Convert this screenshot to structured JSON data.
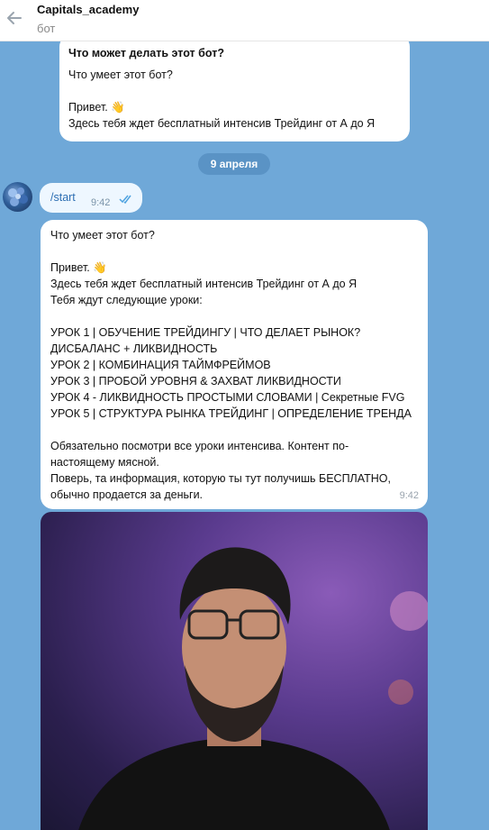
{
  "header": {
    "title": "Capitals_academy",
    "subtitle": "бот"
  },
  "description": {
    "title": "Что может делать этот бот?",
    "lines": [
      "Что умеет этот бот?",
      "",
      "Привет. 👋",
      "Здесь тебя ждет бесплатный интенсив Трейдинг от А до Я"
    ]
  },
  "date_pill": "9 апреля",
  "outgoing": {
    "text": "/start",
    "time": "9:42"
  },
  "message": {
    "lines": [
      "Что умеет этот бот?",
      "",
      "Привет. 👋",
      "Здесь тебя ждет бесплатный интенсив Трейдинг от А до Я",
      "Тебя ждут следующие уроки:",
      "",
      "УРОК 1 | ОБУЧЕНИЕ ТРЕЙДИНГУ | ЧТО ДЕЛАЕТ РЫНОК?",
      "ДИСБАЛАНС + ЛИКВИДНОСТЬ",
      "УРОК 2 | КОМБИНАЦИЯ ТАЙМФРЕЙМОВ",
      "УРОК 3 | ПРОБОЙ УРОВНЯ & ЗАХВАТ ЛИКВИДНОСТИ",
      "УРОК 4 - ЛИКВИДНОСТЬ ПРОСТЫМИ СЛОВАМИ | Секретные FVG",
      "УРОК 5 | СТРУКТУРА РЫНКА ТРЕЙДИНГ | ОПРЕДЕЛЕНИЕ ТРЕНДА",
      "",
      "Обязательно посмотри все уроки интенсива. Контент по-",
      "настоящему мясной.",
      "Поверь, та информация, которую ты тут получишь БЕСПЛАТНО,",
      "обычно продается за деньги."
    ],
    "time": "9:42"
  },
  "colors": {
    "chat_background": "#6fa8d8",
    "outgoing_bubble": "#eef7ff",
    "date_pill": "#5a93c5"
  }
}
